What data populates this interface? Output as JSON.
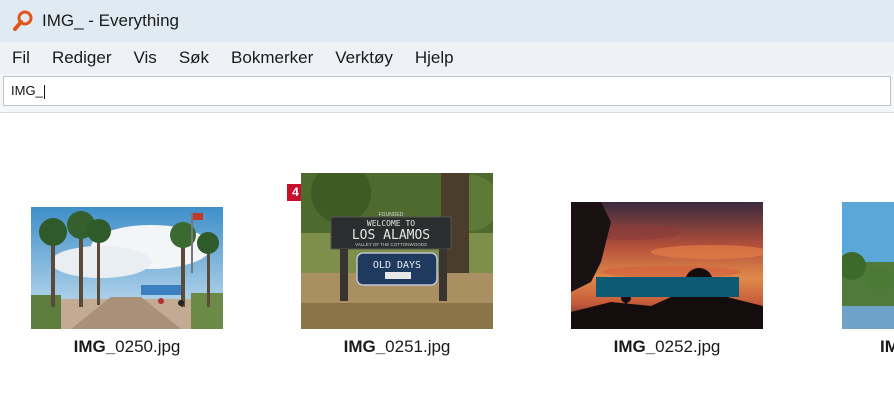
{
  "window": {
    "title": "IMG_ - Everything",
    "app_icon": "magnifier-icon",
    "icon_color": "#e0561b"
  },
  "menu": {
    "items": [
      "Fil",
      "Rediger",
      "Vis",
      "Søk",
      "Bokmerker",
      "Verktøy",
      "Hjelp"
    ]
  },
  "search": {
    "value": "IMG_"
  },
  "results": {
    "items": [
      {
        "bold": "IMG_",
        "rest": "0250.jpg"
      },
      {
        "bold": "IMG_",
        "rest": "0251.jpg",
        "badge": "4"
      },
      {
        "bold": "IMG_",
        "rest": "0252.jpg"
      },
      {
        "bold": "IM",
        "rest": ""
      }
    ]
  },
  "photos": {
    "los_alamos_sign": {
      "line1": "FOUNDED",
      "line2": "WELCOME TO",
      "line3": "LOS ALAMOS",
      "line4": "VALLEY OF THE COTTONWOODS",
      "line5": "OLD DAYS"
    }
  },
  "colors": {
    "badge": "#c8102e",
    "titlebar": "#dfeaf2",
    "menubar": "#eef1f5",
    "teal_block": "#0d5a74"
  }
}
